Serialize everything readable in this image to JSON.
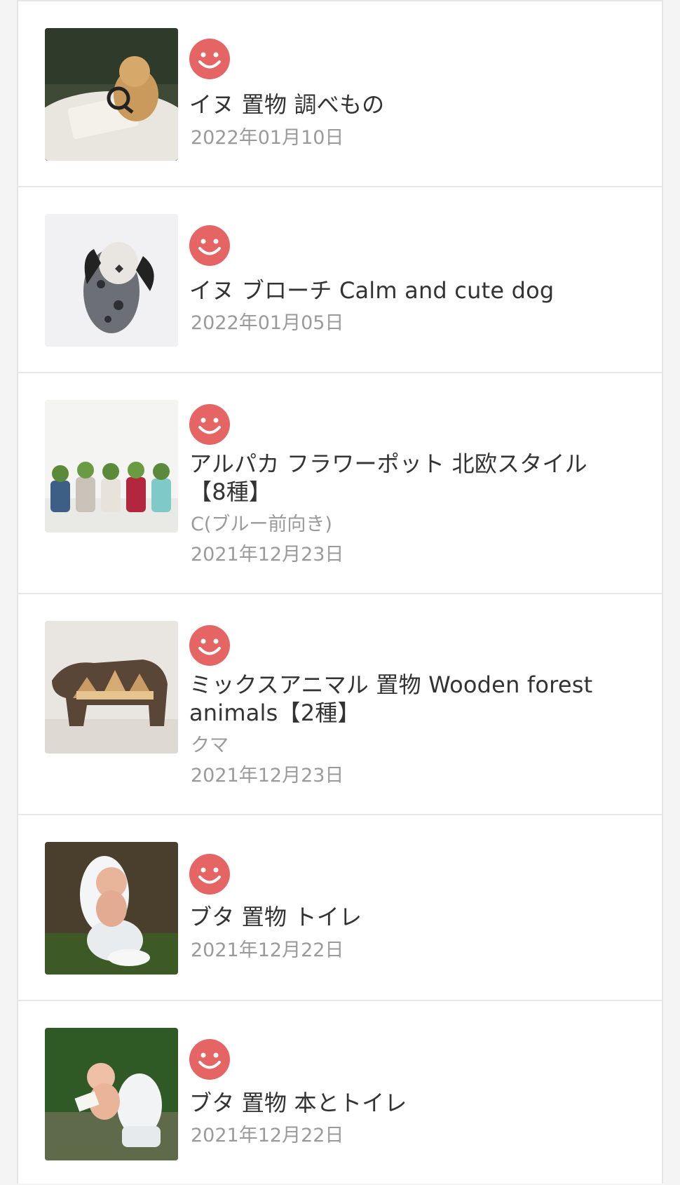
{
  "colors": {
    "smiley": "#e56464",
    "title_text": "#333333",
    "meta_text": "#9a9a9a",
    "divider": "#e8e8e8"
  },
  "items": [
    {
      "image_icon": "dog-magnifier-figurine-image",
      "rating_icon": "smiley-face-icon",
      "title": "イヌ 置物 調べもの",
      "variant": "",
      "date": "2022年01月10日"
    },
    {
      "image_icon": "dog-brooch-image",
      "rating_icon": "smiley-face-icon",
      "title": "イヌ ブローチ Calm and cute dog",
      "variant": "",
      "date": "2022年01月05日"
    },
    {
      "image_icon": "alpaca-flower-pot-image",
      "rating_icon": "smiley-face-icon",
      "title_line1": "アルパカ フラワーポット 北欧スタイル",
      "title_line2": "【8種】",
      "variant": "C(ブルー前向き)",
      "date": "2021年12月23日"
    },
    {
      "image_icon": "wooden-bear-image",
      "rating_icon": "smiley-face-icon",
      "title_line1": "ミックスアニマル 置物 Wooden forest",
      "title_line2": "animals【2種】",
      "variant": "クマ",
      "date": "2021年12月23日"
    },
    {
      "image_icon": "pig-toilet-figurine-image",
      "rating_icon": "smiley-face-icon",
      "title": "ブタ 置物 トイレ",
      "variant": "",
      "date": "2021年12月22日"
    },
    {
      "image_icon": "pig-book-toilet-figurine-image",
      "rating_icon": "smiley-face-icon",
      "title": "ブタ 置物 本とトイレ",
      "variant": "",
      "date": "2021年12月22日"
    }
  ]
}
